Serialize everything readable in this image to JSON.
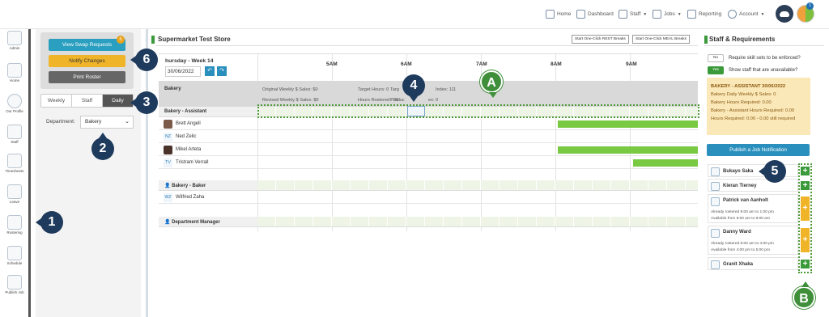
{
  "nav": {
    "items": [
      {
        "label": "Home",
        "icon": "home-icon",
        "dropdown": false
      },
      {
        "label": "Dashboard",
        "icon": "dashboard-icon",
        "dropdown": false
      },
      {
        "label": "Staff",
        "icon": "staff-icon",
        "dropdown": true
      },
      {
        "label": "Jobs",
        "icon": "jobs-icon",
        "dropdown": true
      },
      {
        "label": "Reporting",
        "icon": "reporting-icon",
        "dropdown": false
      },
      {
        "label": "Account",
        "icon": "account-icon",
        "dropdown": true
      }
    ],
    "notification_count": "1"
  },
  "rail": {
    "items": [
      {
        "label": "Admin"
      },
      {
        "label": "Home"
      },
      {
        "label": "Our Profile"
      },
      {
        "label": "Staff"
      },
      {
        "label": "Timesheets"
      },
      {
        "label": "Leave"
      },
      {
        "label": "Rostering"
      },
      {
        "label": "Schedule"
      },
      {
        "label": "Publish Job"
      }
    ]
  },
  "left_panel": {
    "swap_label": "View Swap Requests",
    "swap_badge": "6",
    "notify_label": "Notify Changes",
    "print_label": "Print Roster",
    "tabs": [
      "Weekly",
      "Staff",
      "Daily"
    ],
    "active_tab": "Daily",
    "department_label": "Department:",
    "department_value": "Bakery"
  },
  "schedule": {
    "store_title": "Supermarket Test Store",
    "rest_breaks_label": "Start One-Click REST Breaks",
    "meal_breaks_label": "Start One-Click MEAL Breaks",
    "week_header": "hursday - Week 14",
    "date": "30/06/2022",
    "hours": [
      "5AM",
      "6AM",
      "7AM",
      "8AM",
      "9AM"
    ],
    "department": {
      "name": "Bakery",
      "original_sales": "Original Weekly $ Sales: $0",
      "revised_sales": "Revised Weekly $ Sales: $0",
      "target_hours": "Target Hours: 0",
      "hours_rostered": "Hours Rostered : 38",
      "target_index": "Targ",
      "index_label": "Index: 111",
      "product_label": "Produc",
      "product_index": "ex: 0"
    },
    "groups": [
      {
        "name": "Bakery - Assistant",
        "staff": [
          {
            "name": "Brett Angell",
            "avatar": "photo",
            "initials": ""
          },
          {
            "name": "Ned Zelic",
            "avatar": "initials",
            "initials": "NZ"
          },
          {
            "name": "Mikel Arteta",
            "avatar": "photo",
            "initials": ""
          },
          {
            "name": "Tristram Verrall",
            "avatar": "initials",
            "initials": "TV"
          }
        ]
      },
      {
        "name": "Bakery - Baker",
        "staff": [
          {
            "name": "Wilfried Zaha",
            "avatar": "initials",
            "initials": "WZ"
          }
        ]
      },
      {
        "name": "Department Manager",
        "staff": []
      }
    ]
  },
  "right_panel": {
    "title": "Staff & Requirements",
    "toggle1": {
      "state": "No",
      "label": "Require skill sets to be enforced?"
    },
    "toggle2": {
      "state": "Yes",
      "label": "Show staff that are unavailable?"
    },
    "note": {
      "heading": "BAKERY - ASSISTANT 30/06/2022",
      "lines": [
        "Bakery Daily Weekly $ Sales: 0",
        "Bakery Hours Required: 0.00",
        "Bakery - Assistant Hours Required: 0.00",
        "Hours Required: 0.00 - 0.00 still required"
      ]
    },
    "publish_label": "Publish a Job Notification",
    "candidates": [
      {
        "name": "Bukayo Saka",
        "lines": [],
        "status": "available"
      },
      {
        "name": "Kieran Tierney",
        "lines": [],
        "status": "available"
      },
      {
        "name": "Patrick van Aanholt",
        "lines": [
          "Already rostered 9:00 am to 1:00 pm",
          "Available from 8:00 am to 9:00 am"
        ],
        "status": "partial"
      },
      {
        "name": "Danny Ward",
        "lines": [
          "Already rostered 8:00 am to 4:00 pm",
          "Available from 4:00 pm to 5:00 pm"
        ],
        "status": "partial"
      },
      {
        "name": "Granit Xhaka",
        "lines": [],
        "status": "available"
      }
    ]
  },
  "callouts": [
    "1",
    "2",
    "3",
    "4",
    "5",
    "6",
    "A",
    "B"
  ],
  "colors": {
    "accent_blue": "#2a8fbd",
    "notify_orange": "#f0b429",
    "shift_green": "#7ac943",
    "callout_navy": "#1e3a5c",
    "callout_green": "#3f8f3a"
  }
}
